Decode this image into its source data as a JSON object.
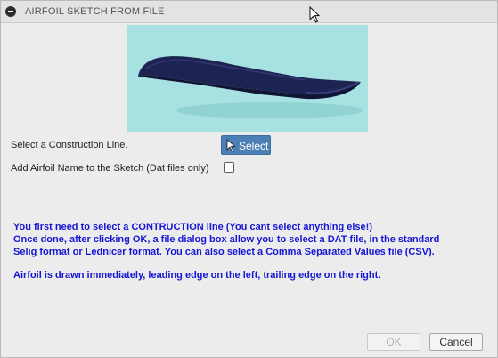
{
  "window": {
    "title": "AIRFOIL SKETCH FROM FILE"
  },
  "icons": {
    "collapse": "minus-circle-icon",
    "cursor": "mouse-pointer-icon",
    "select_arrow": "select-arrow-icon"
  },
  "colors": {
    "preview_bg": "#a8e1e1",
    "airfoil": "#1e2452",
    "select_button": "#4b7fb6",
    "info_text": "#1515d6"
  },
  "form": {
    "construction_label": "Select a Construction Line.",
    "select_button_label": "Select",
    "airfoil_name_label": "Add Airfoil Name to the Sketch (Dat files only)",
    "airfoil_name_checked": false
  },
  "info": {
    "line1": "You first need to select a CONTRUCTION line  (You cant select anything else!)",
    "line2": "Once done, after clicking OK, a file dialog box allow you to select a DAT file, in the standard",
    "line3": "Selig format or Lednicer format. You can also select a Comma Separated Values file (CSV).",
    "line4": "Airfoil is drawn immediately, leading edge on the left, trailing edge on the right."
  },
  "footer": {
    "ok_label": "OK",
    "cancel_label": "Cancel",
    "ok_enabled": false
  }
}
